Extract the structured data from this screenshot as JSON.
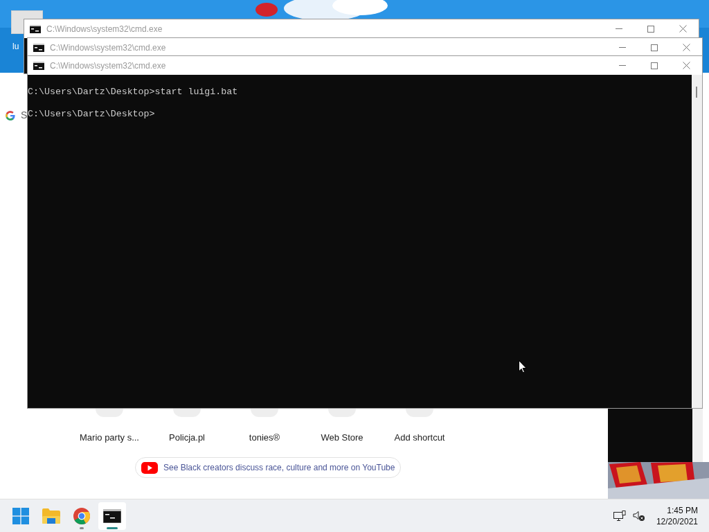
{
  "desktop": {
    "icons": [
      {
        "label": "lu"
      }
    ]
  },
  "browser": {
    "search": {
      "placeholder": "S"
    },
    "shortcuts": [
      {
        "label": "Mario party s..."
      },
      {
        "label": "Policja.pl"
      },
      {
        "label": "tonies®"
      },
      {
        "label": "Web Store"
      },
      {
        "label": "Add shortcut"
      }
    ],
    "promo": {
      "text": "See Black creators discuss race, culture and more on YouTube"
    }
  },
  "windows": [
    {
      "title": "C:\\Windows\\system32\\cmd.exe"
    },
    {
      "title": "C:\\Windows\\system32\\cmd.exe"
    },
    {
      "title": "C:\\Windows\\system32\\cmd.exe",
      "lines": [
        "C:\\Users\\Dartz\\Desktop>start luigi.bat",
        "C:\\Users\\Dartz\\Desktop>"
      ]
    }
  ],
  "taskbar": {
    "apps": [
      {
        "kind": "start",
        "running": false,
        "selected": false
      },
      {
        "kind": "folder",
        "running": false,
        "selected": false
      },
      {
        "kind": "browser",
        "running": true,
        "selected": false
      },
      {
        "kind": "terminal",
        "running": true,
        "selected": true
      }
    ],
    "clock": {
      "time": "1:45 PM",
      "date": "12/20/2021"
    }
  }
}
